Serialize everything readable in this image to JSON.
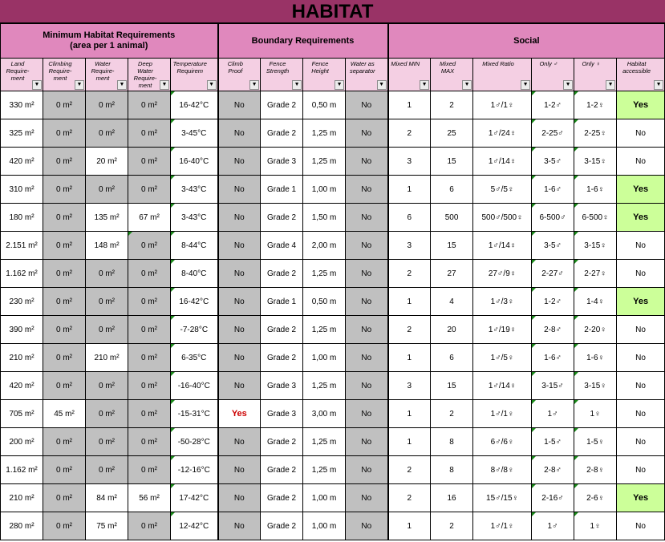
{
  "title": "HABITAT",
  "groups": {
    "min": "Minimum Habitat Requirements\n(area per 1 animal)",
    "boundary": "Boundary Requirements",
    "social": "Social"
  },
  "headers": [
    "Land Require- ment",
    "Climbing Require- ment",
    "Water Require- ment",
    "Deep Water Require- ment",
    "Temperature Requirem",
    "Climb Proof",
    "Fence Strength",
    "Fence Height",
    "Water as separator",
    "Mixed MIN",
    "Mixed MAX",
    "Mixed Ratio",
    "Only ♂",
    "Only ♀",
    "Habitat accessible"
  ],
  "dropdown_glyph": "▼",
  "rows": [
    [
      "330 m²",
      "0 m²",
      "0 m²",
      "0 m²",
      "16-42°C",
      "No",
      "Grade 2",
      "0,50 m",
      "No",
      "1",
      "2",
      "1♂/1♀",
      "1-2♂",
      "1-2♀",
      "Yes"
    ],
    [
      "325 m²",
      "0 m²",
      "0 m²",
      "0 m²",
      "3-45°C",
      "No",
      "Grade 2",
      "1,25 m",
      "No",
      "2",
      "25",
      "1♂/24♀",
      "2-25♂",
      "2-25♀",
      "No"
    ],
    [
      "420 m²",
      "0 m²",
      "20 m²",
      "0 m²",
      "16-40°C",
      "No",
      "Grade 3",
      "1,25 m",
      "No",
      "3",
      "15",
      "1♂/14♀",
      "3-5♂",
      "3-15♀",
      "No"
    ],
    [
      "310 m²",
      "0 m²",
      "0 m²",
      "0 m²",
      "3-43°C",
      "No",
      "Grade 1",
      "1,00 m",
      "No",
      "1",
      "6",
      "5♂/5♀",
      "1-6♂",
      "1-6♀",
      "Yes"
    ],
    [
      "180 m²",
      "0 m²",
      "135 m²",
      "67 m²",
      "3-43°C",
      "No",
      "Grade 2",
      "1,50 m",
      "No",
      "6",
      "500",
      "500♂/500♀",
      "6-500♂",
      "6-500♀",
      "Yes"
    ],
    [
      "2.151 m²",
      "0 m²",
      "148 m²",
      "0 m²",
      "8-44°C",
      "No",
      "Grade 4",
      "2,00 m",
      "No",
      "3",
      "15",
      "1♂/14♀",
      "3-5♂",
      "3-15♀",
      "No"
    ],
    [
      "1.162 m²",
      "0 m²",
      "0 m²",
      "0 m²",
      "8-40°C",
      "No",
      "Grade 2",
      "1,25 m",
      "No",
      "2",
      "27",
      "27♂/9♀",
      "2-27♂",
      "2-27♀",
      "No"
    ],
    [
      "230 m²",
      "0 m²",
      "0 m²",
      "0 m²",
      "16-42°C",
      "No",
      "Grade 1",
      "0,50 m",
      "No",
      "1",
      "4",
      "1♂/3♀",
      "1-2♂",
      "1-4♀",
      "Yes"
    ],
    [
      "390 m²",
      "0 m²",
      "0 m²",
      "0 m²",
      "-7-28°C",
      "No",
      "Grade 2",
      "1,25 m",
      "No",
      "2",
      "20",
      "1♂/19♀",
      "2-8♂",
      "2-20♀",
      "No"
    ],
    [
      "210 m²",
      "0 m²",
      "210 m²",
      "0 m²",
      "6-35°C",
      "No",
      "Grade 2",
      "1,00 m",
      "No",
      "1",
      "6",
      "1♂/5♀",
      "1-6♂",
      "1-6♀",
      "No"
    ],
    [
      "420 m²",
      "0 m²",
      "0 m²",
      "0 m²",
      "-16-40°C",
      "No",
      "Grade 3",
      "1,25 m",
      "No",
      "3",
      "15",
      "1♂/14♀",
      "3-15♂",
      "3-15♀",
      "No"
    ],
    [
      "705 m²",
      "45 m²",
      "0 m²",
      "0 m²",
      "-15-31°C",
      "Yes",
      "Grade 3",
      "3,00 m",
      "No",
      "1",
      "2",
      "1♂/1♀",
      "1♂",
      "1♀",
      "No"
    ],
    [
      "200 m²",
      "0 m²",
      "0 m²",
      "0 m²",
      "-50-28°C",
      "No",
      "Grade 2",
      "1,25 m",
      "No",
      "1",
      "8",
      "6♂/6♀",
      "1-5♂",
      "1-5♀",
      "No"
    ],
    [
      "1.162 m²",
      "0 m²",
      "0 m²",
      "0 m²",
      "-12-16°C",
      "No",
      "Grade 2",
      "1,25 m",
      "No",
      "2",
      "8",
      "8♂/8♀",
      "2-8♂",
      "2-8♀",
      "No"
    ],
    [
      "210 m²",
      "0 m²",
      "84 m²",
      "56 m²",
      "17-42°C",
      "No",
      "Grade 2",
      "1,00 m",
      "No",
      "2",
      "16",
      "15♂/15♀",
      "2-16♂",
      "2-6♀",
      "Yes"
    ],
    [
      "280 m²",
      "0 m²",
      "75 m²",
      "0 m²",
      "12-42°C",
      "No",
      "Grade 2",
      "1,00 m",
      "No",
      "1",
      "2",
      "1♂/1♀",
      "1♂",
      "1♀",
      "No"
    ]
  ]
}
